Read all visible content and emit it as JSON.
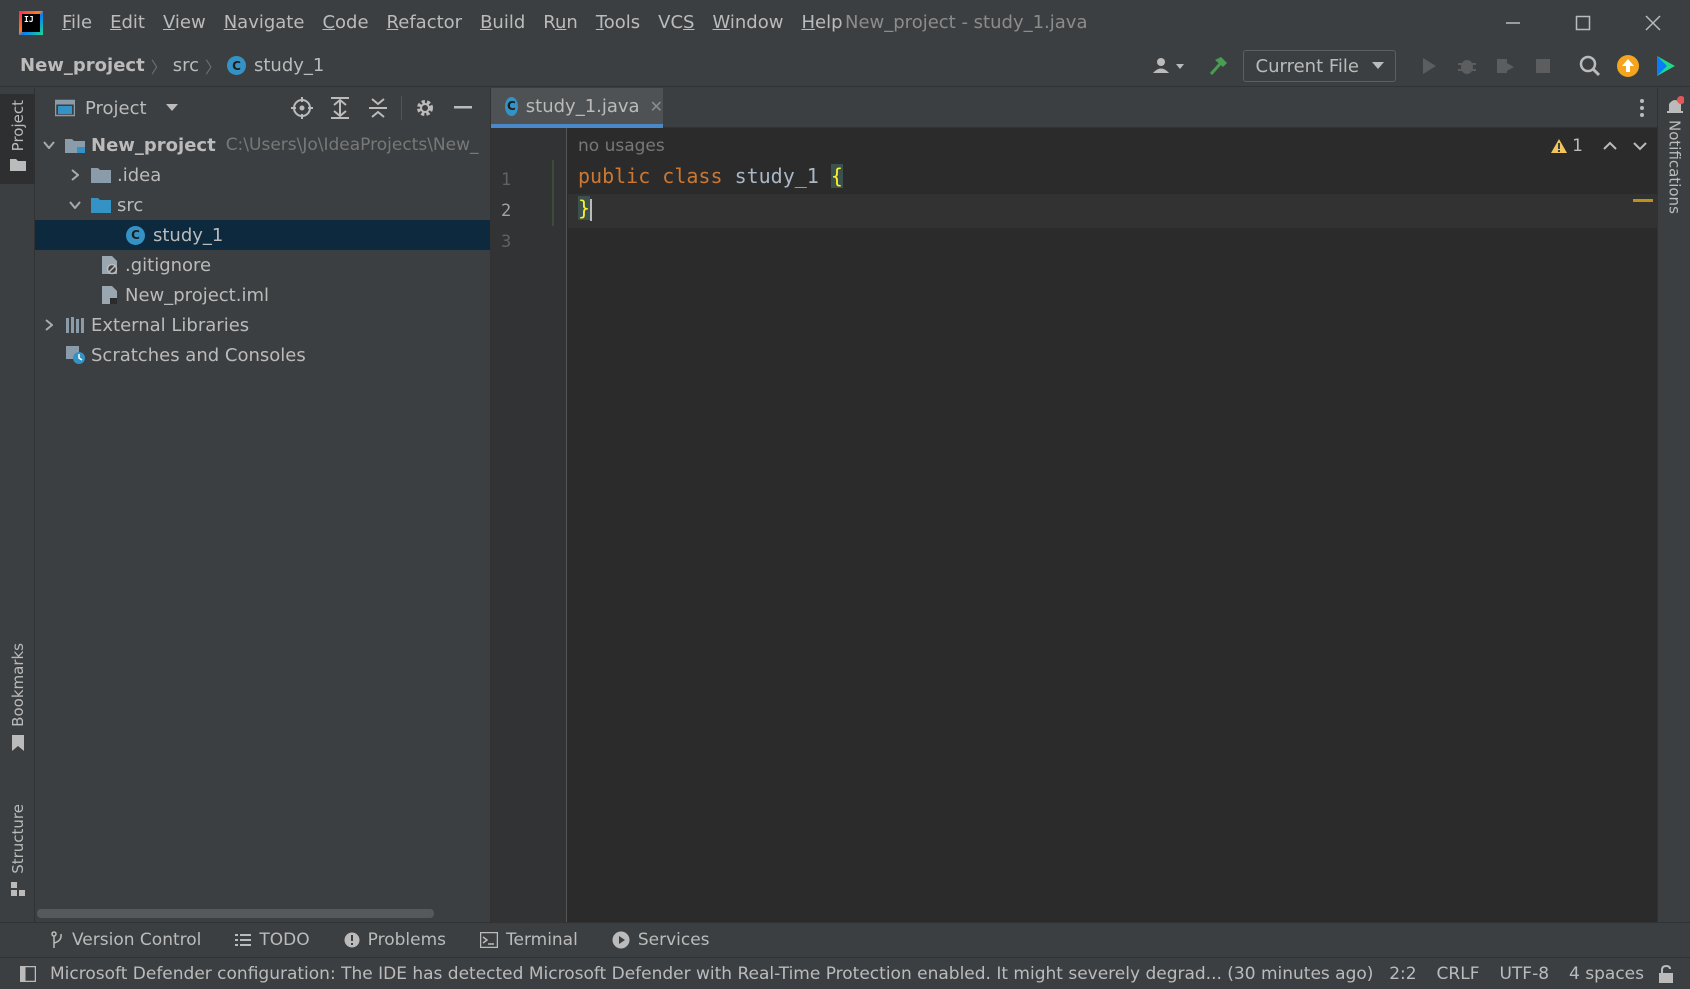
{
  "titlebar": {
    "menu": [
      {
        "pre": "",
        "ul": "F",
        "post": "ile"
      },
      {
        "pre": "",
        "ul": "E",
        "post": "dit"
      },
      {
        "pre": "",
        "ul": "V",
        "post": "iew"
      },
      {
        "pre": "",
        "ul": "N",
        "post": "avigate"
      },
      {
        "pre": "",
        "ul": "C",
        "post": "ode"
      },
      {
        "pre": "",
        "ul": "R",
        "post": "efactor"
      },
      {
        "pre": "",
        "ul": "B",
        "post": "uild"
      },
      {
        "pre": "R",
        "ul": "u",
        "post": "n"
      },
      {
        "pre": "",
        "ul": "T",
        "post": "ools"
      },
      {
        "pre": "VC",
        "ul": "S",
        "post": ""
      },
      {
        "pre": "",
        "ul": "W",
        "post": "indow"
      },
      {
        "pre": "",
        "ul": "H",
        "post": "elp"
      }
    ],
    "window_title": "New_project - study_1.java",
    "logo_text": "IJ"
  },
  "navbar": {
    "project": "New_project",
    "folder": "src",
    "file": "study_1",
    "class_icon_letter": "C",
    "run_config": "Current File"
  },
  "left_stripe": {
    "project": "Project",
    "bookmarks": "Bookmarks",
    "structure": "Structure"
  },
  "right_stripe": {
    "notifications": "Notifications"
  },
  "project_panel": {
    "title": "Project",
    "tree": {
      "root": "New_project",
      "root_path": "C:\\Users\\Jo\\IdeaProjects\\New_",
      "idea": ".idea",
      "src": "src",
      "study": "study_1",
      "gitignore": ".gitignore",
      "iml": "New_project.iml",
      "external": "External Libraries",
      "scratches": "Scratches and Consoles"
    }
  },
  "editor": {
    "tab_label": "study_1.java",
    "hint": "no usages",
    "line_numbers": [
      "1",
      "2",
      "3"
    ],
    "code_keyword1": "public",
    "code_keyword2": "class",
    "code_class": "study_1",
    "open_brace": "{",
    "close_brace": "}",
    "warning_count": "1"
  },
  "bottom_bar": {
    "version_control": "Version Control",
    "todo": "TODO",
    "problems": "Problems",
    "terminal": "Terminal",
    "services": "Services"
  },
  "status_bar": {
    "message": "Microsoft Defender configuration: The IDE has detected Microsoft Defender with Real-Time Protection enabled. It might severely degrad... (30 minutes ago)",
    "position": "2:2",
    "line_separator": "CRLF",
    "encoding": "UTF-8",
    "indent": "4 spaces"
  },
  "colors": {
    "background": "#3c3f41",
    "editor_bg": "#2b2b2b",
    "keyword": "#cc7832",
    "identifier": "#a9b7c6",
    "selection": "#0d293e",
    "accent": "#4a88c7",
    "warning": "#be9117"
  }
}
